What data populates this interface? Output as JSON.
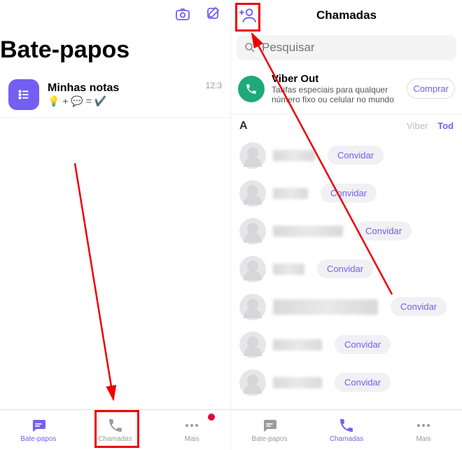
{
  "colors": {
    "accent": "#7360F2",
    "annotation": "#e00000",
    "green": "#1fa97a"
  },
  "left": {
    "title": "Bate-papos",
    "chat": {
      "name": "Minhas notas",
      "preview": "💡 + 💬 = ✔️",
      "time": "12:3"
    },
    "nav": {
      "chats": "Bate-papos",
      "calls": "Chamadas",
      "more": "Mais"
    }
  },
  "right": {
    "title": "Chamadas",
    "search_placeholder": "Pesquisar",
    "viberout": {
      "title": "Viber Out",
      "subtitle": "Tarifas especiais para qualquer número fixo ou celular no mundo",
      "buy": "Comprar"
    },
    "section_letter": "A",
    "filter_viber": "Viber",
    "filter_all": "Tod",
    "invite": "Convidar",
    "nav": {
      "chats": "Bate-papos",
      "calls": "Chamadas",
      "more": "Mais"
    }
  }
}
